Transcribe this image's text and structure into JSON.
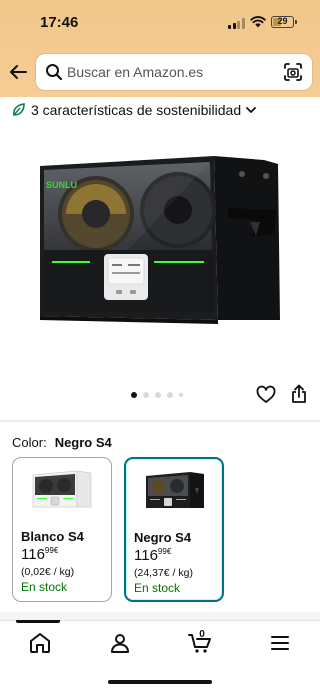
{
  "status_bar": {
    "time": "17:46",
    "battery": "29"
  },
  "search": {
    "placeholder": "Buscar en Amazon.es"
  },
  "sustainability": {
    "text": "3 características de sostenibilidad"
  },
  "product": {
    "image_alt": "Secador de filamento negro con dos bobinas",
    "brand_mark": "SUNLU",
    "carousel": {
      "count": 5,
      "active_index": 0
    }
  },
  "color_selector": {
    "label": "Color:",
    "selected": "Negro S4",
    "options": [
      {
        "name": "Blanco S4",
        "price_whole": "116",
        "price_fraction": "99",
        "currency": "€",
        "unit_price": "(0,02€ / kg)",
        "stock": "En stock",
        "selected": false
      },
      {
        "name": "Negro S4",
        "price_whole": "116",
        "price_fraction": "99",
        "currency": "€",
        "unit_price": "(24,37€ / kg)",
        "stock": "En stock",
        "selected": true
      }
    ]
  },
  "tab_bar": {
    "items": [
      {
        "name": "home-icon",
        "active": true
      },
      {
        "name": "account-icon",
        "active": false
      },
      {
        "name": "cart-icon",
        "active": false
      },
      {
        "name": "menu-icon",
        "active": false
      }
    ],
    "cart_count": "0"
  },
  "colors": {
    "accent": "#007185",
    "stock": "#007600",
    "header": "#f2c68a",
    "leaf": "#067d62"
  }
}
